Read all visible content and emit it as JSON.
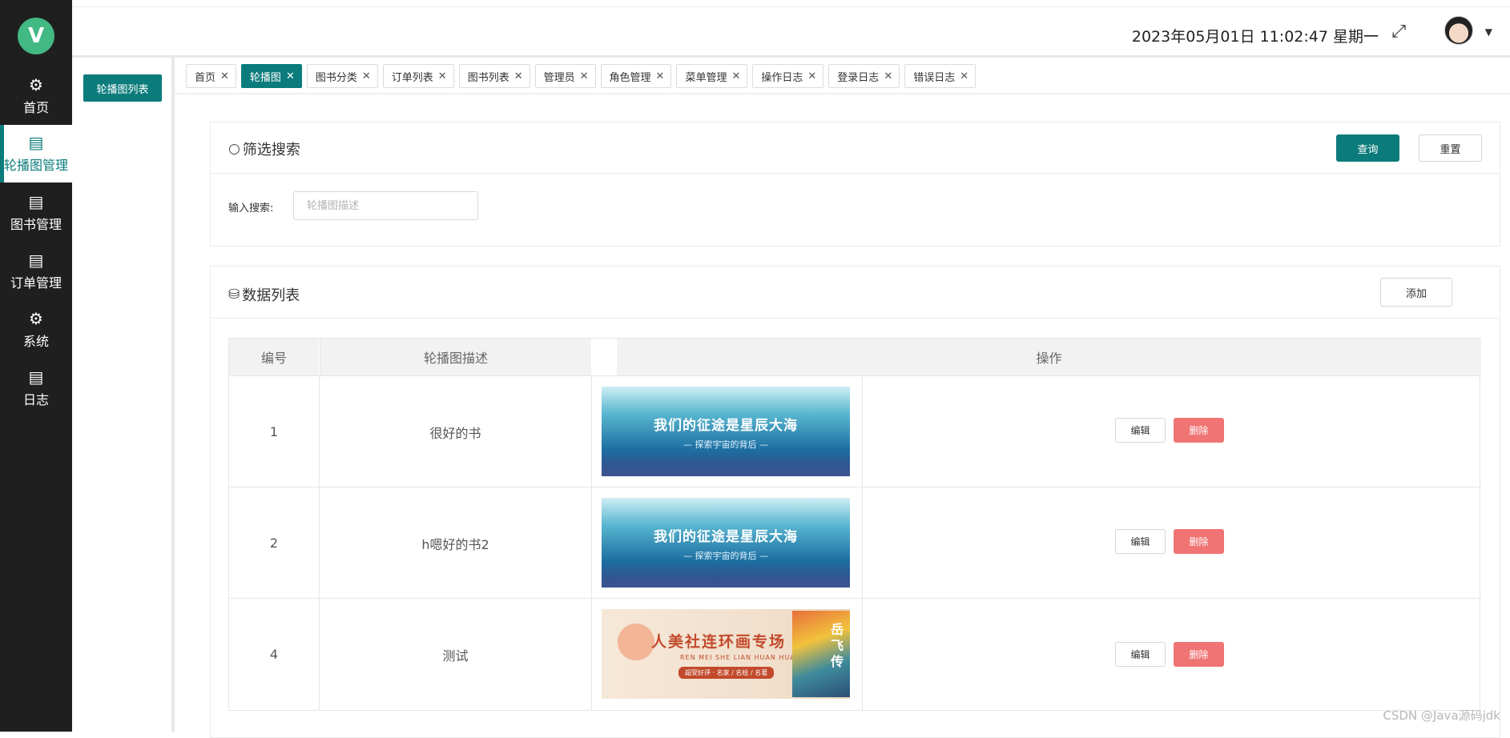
{
  "sidebar": {
    "logo": "V",
    "items": [
      {
        "label": "首页",
        "icon": "gear-icon"
      },
      {
        "label": "轮播图管理",
        "icon": "clipboard-icon",
        "active": true
      },
      {
        "label": "图书管理",
        "icon": "clipboard-icon"
      },
      {
        "label": "订单管理",
        "icon": "clipboard-icon"
      },
      {
        "label": "系统",
        "icon": "gear-icon"
      },
      {
        "label": "日志",
        "icon": "clipboard-icon"
      }
    ]
  },
  "subsidebar": {
    "active_item": "轮播图列表"
  },
  "header": {
    "datetime": "2023年05月01日 11:02:47 星期一"
  },
  "tabs": [
    {
      "label": "首页"
    },
    {
      "label": "轮播图",
      "active": true
    },
    {
      "label": "图书分类"
    },
    {
      "label": "订单列表"
    },
    {
      "label": "图书列表"
    },
    {
      "label": "管理员"
    },
    {
      "label": "角色管理"
    },
    {
      "label": "菜单管理"
    },
    {
      "label": "操作日志"
    },
    {
      "label": "登录日志"
    },
    {
      "label": "错误日志"
    }
  ],
  "filter": {
    "title": "筛选搜索",
    "query_label": "查询",
    "reset_label": "重置",
    "search_label": "输入搜索:",
    "search_placeholder": "轮播图描述"
  },
  "list": {
    "title": "数据列表",
    "add_label": "添加",
    "columns": [
      "编号",
      "轮播图描述",
      "操作"
    ],
    "edit_label": "编辑",
    "delete_label": "删除",
    "rows": [
      {
        "id": "1",
        "desc": "很好的书",
        "banner": {
          "style": "sea",
          "line1": "我们的征途是星辰大海",
          "line2": "— 探索宇宙的背后 —"
        }
      },
      {
        "id": "2",
        "desc": "h嗯好的书2",
        "banner": {
          "style": "sea",
          "line1": "我们的征途是星辰大海",
          "line2": "— 探索宇宙的背后 —"
        }
      },
      {
        "id": "4",
        "desc": "测试",
        "banner": {
          "style": "art",
          "line1": "人美社连环画专场",
          "line2": "REN MEI SHE LIAN HUAN HUA",
          "line3": "超受好评 · 名家 / 名绘 / 名著",
          "poster": "岳飞传"
        }
      }
    ]
  },
  "watermark": "CSDN @Java源码jdk",
  "colors": {
    "primary": "#0b7b7b",
    "danger": "#f07474",
    "sidebar": "#1f1f20"
  }
}
